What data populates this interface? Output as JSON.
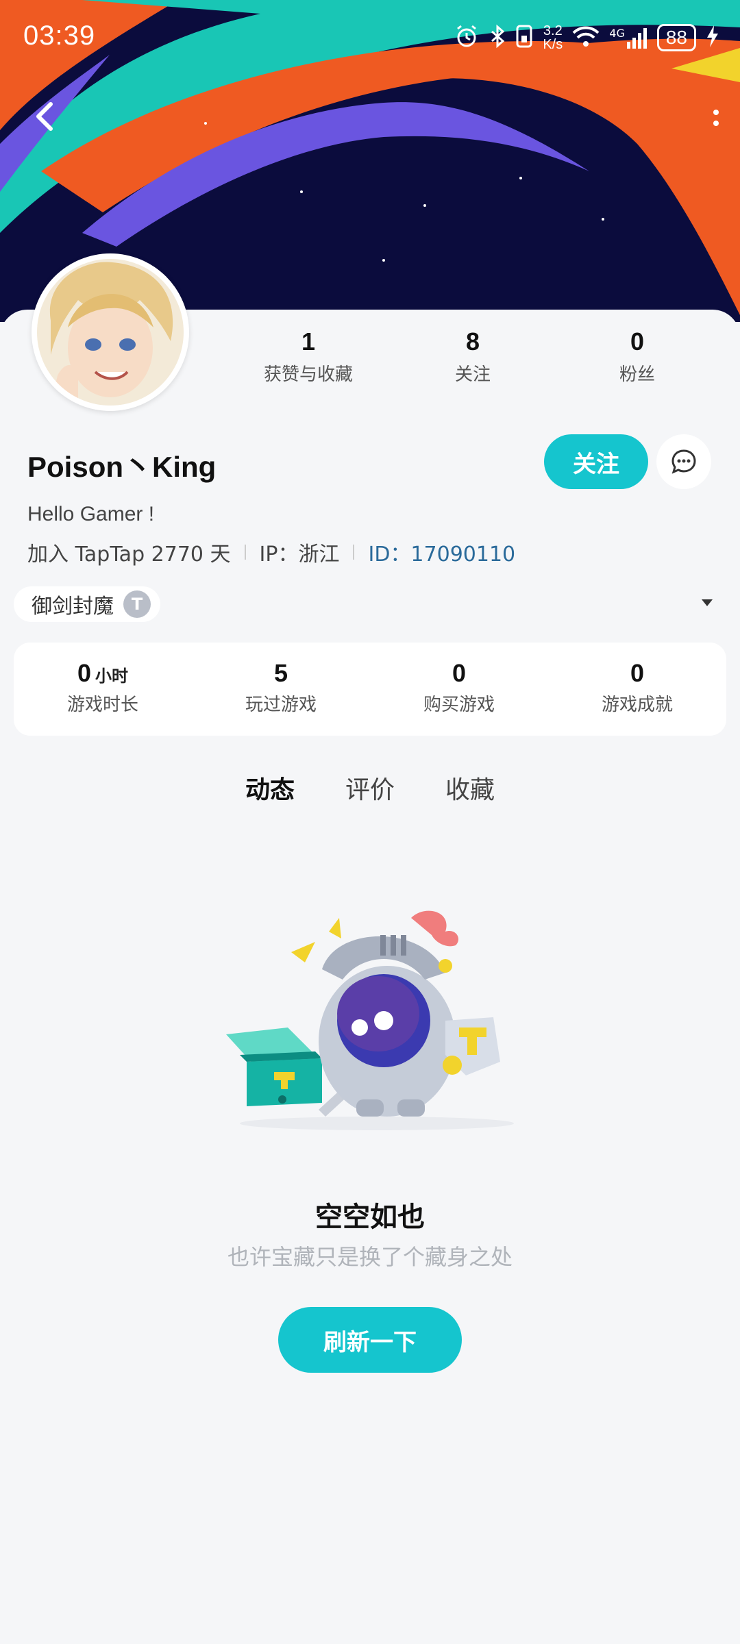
{
  "status_bar": {
    "time": "03:39",
    "net_speed_value": "3.2",
    "net_speed_unit": "K/s",
    "battery": "88",
    "network": "4G"
  },
  "profile": {
    "username": "Poison丶King",
    "bio": "Hello Gamer !",
    "joined": "加入 TapTap 2770 天",
    "ip": "IP：浙江",
    "id": "ID：17090110",
    "follow_label": "关注"
  },
  "top_stats": [
    {
      "value": "1",
      "label": "获赞与收藏"
    },
    {
      "value": "8",
      "label": "关注"
    },
    {
      "value": "0",
      "label": "粉丝"
    }
  ],
  "badge": {
    "label": "御剑封魔",
    "logo": "T"
  },
  "game_stats": [
    {
      "value": "0",
      "unit": "小时",
      "label": "游戏时长"
    },
    {
      "value": "5",
      "unit": "",
      "label": "玩过游戏"
    },
    {
      "value": "0",
      "unit": "",
      "label": "购买游戏"
    },
    {
      "value": "0",
      "unit": "",
      "label": "游戏成就"
    }
  ],
  "tabs": [
    {
      "label": "动态",
      "active": true
    },
    {
      "label": "评价",
      "active": false
    },
    {
      "label": "收藏",
      "active": false
    }
  ],
  "empty_state": {
    "title": "空空如也",
    "subtitle": "也许宝藏只是换了个藏身之处",
    "button": "刷新一下"
  },
  "colors": {
    "accent": "#15c5ce",
    "banner_bg": "#0b0c3d",
    "stripe_orange": "#ef5a22",
    "stripe_teal": "#19c6b5",
    "stripe_purple": "#6a55e0",
    "id_blue": "#2a6a9a"
  }
}
